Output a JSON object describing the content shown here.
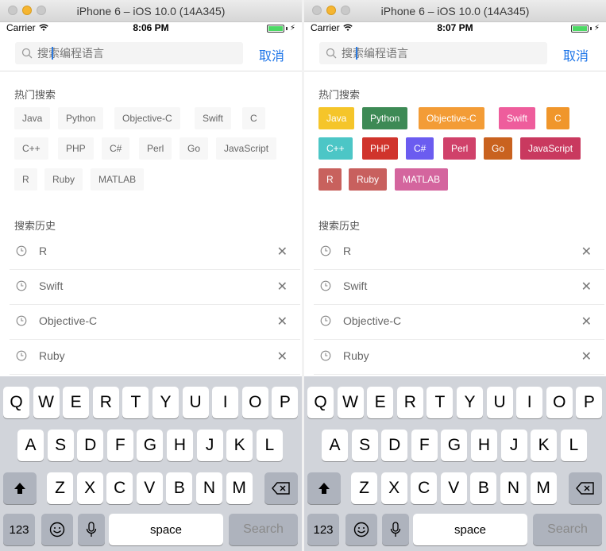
{
  "window_title": "iPhone 6 – iOS 10.0 (14A345)",
  "status": {
    "carrier": "Carrier",
    "time_left": "8:06 PM",
    "time_right": "8:07 PM"
  },
  "search": {
    "placeholder": "搜索编程语言",
    "cancel_label": "取消"
  },
  "hot_title": "热门搜索",
  "history_title": "搜索历史",
  "hot_tags": [
    {
      "label": "Java",
      "color": "#f5c52a"
    },
    {
      "label": "Python",
      "color": "#3d8a55"
    },
    {
      "label": "Objective-C",
      "color": "#f39c36"
    },
    {
      "label": "Swift",
      "color": "#ee5d9c"
    },
    {
      "label": "C",
      "color": "#f0962b"
    },
    {
      "label": "C++",
      "color": "#4cc6c6"
    },
    {
      "label": "PHP",
      "color": "#d0342c"
    },
    {
      "label": "C#",
      "color": "#6b5cf0"
    },
    {
      "label": "Perl",
      "color": "#d0416a"
    },
    {
      "label": "Go",
      "color": "#c9621f"
    },
    {
      "label": "JavaScript",
      "color": "#c9395f"
    },
    {
      "label": "R",
      "color": "#c8615d"
    },
    {
      "label": "Ruby",
      "color": "#c8605e"
    },
    {
      "label": "MATLAB",
      "color": "#d4659e"
    }
  ],
  "history": [
    "R",
    "Swift",
    "Objective-C",
    "Ruby"
  ],
  "keyboard": {
    "row1": [
      "Q",
      "W",
      "E",
      "R",
      "T",
      "Y",
      "U",
      "I",
      "O",
      "P"
    ],
    "row2": [
      "A",
      "S",
      "D",
      "F",
      "G",
      "H",
      "J",
      "K",
      "L"
    ],
    "row3": [
      "Z",
      "X",
      "C",
      "V",
      "B",
      "N",
      "M"
    ],
    "numbers_label": "123",
    "space_label": "space",
    "search_label": "Search"
  }
}
